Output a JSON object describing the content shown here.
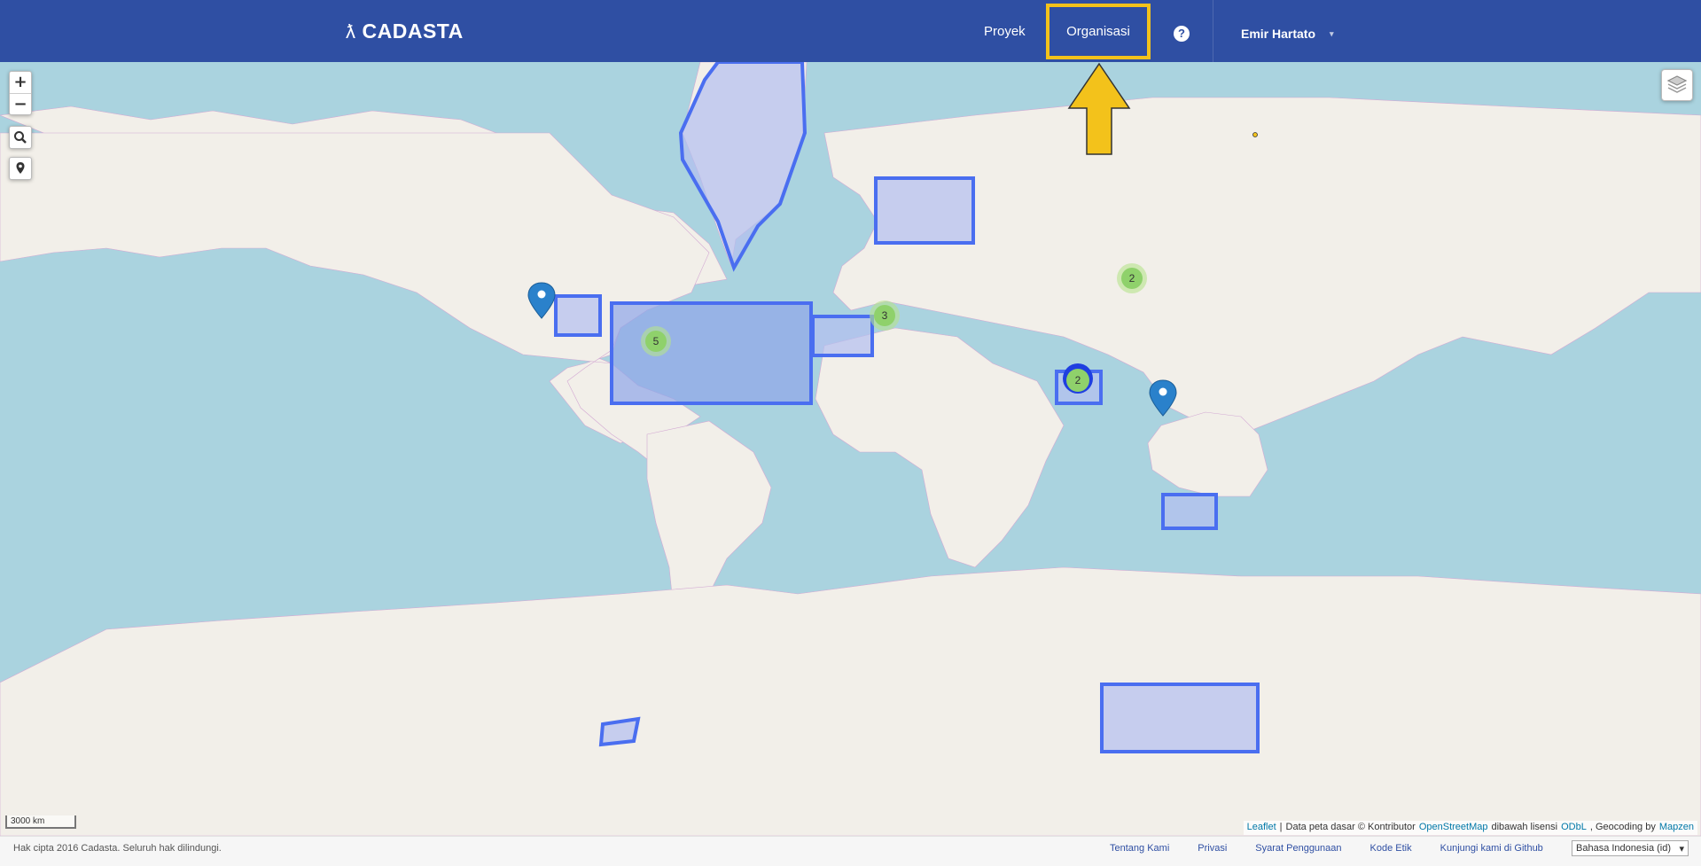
{
  "header": {
    "logo_text": "CADASTA",
    "logo_mark": "ƛ",
    "nav": {
      "projects": "Proyek",
      "organizations": "Organisasi"
    },
    "help_icon": "?",
    "user_name": "Emir Hartato",
    "user_caret": "▾"
  },
  "map": {
    "zoom_in": "+",
    "zoom_out": "−",
    "search_icon": "search-icon",
    "locate_icon": "map-marker-icon",
    "layers_icon": "layers-icon",
    "clusters": [
      "5",
      "3",
      "2",
      "2"
    ],
    "scale_label": "3000 km",
    "attribution": {
      "leaflet": "Leaflet",
      "sep": "|",
      "text1": "Data peta dasar © Kontributor",
      "osm": "OpenStreetMap",
      "text2": "dibawah lisensi",
      "odbl": "ODbL",
      "text3": ", Geocoding by",
      "mapzen": "Mapzen"
    }
  },
  "footer": {
    "copyright": "Hak cipta 2016 Cadasta. Seluruh hak dilindungi.",
    "links": [
      "Tentang Kami",
      "Privasi",
      "Syarat Penggunaan",
      "Kode Etik",
      "Kunjungi kami di Github"
    ],
    "language": "Bahasa Indonesia (id)",
    "language_caret": "▾"
  },
  "colors": {
    "header_bg": "#2f4fa3",
    "highlight": "#f3c21b",
    "polygon_fill": "#b4bff0",
    "polygon_stroke": "#4a6ef0",
    "cluster": "#8fd16b",
    "marker": "#2a81cb"
  }
}
